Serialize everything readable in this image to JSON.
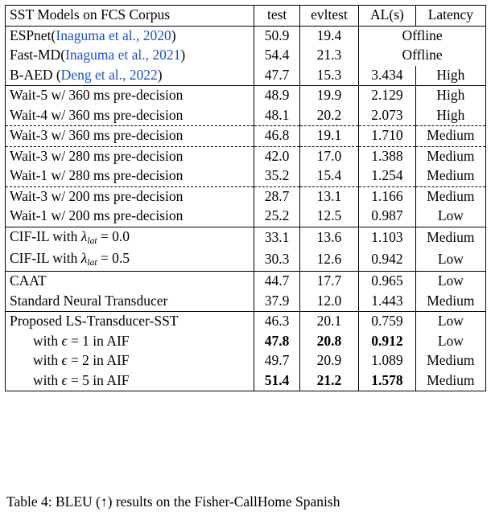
{
  "table": {
    "header": {
      "col0": "SST Models on FCS Corpus",
      "col1": "test",
      "col2": "evltest",
      "col3": "AL(s)",
      "col4": "Latency"
    },
    "groups": [
      {
        "rows": [
          {
            "name_parts": [
              {
                "text": "ESPnet(",
                "style": "plain"
              },
              {
                "text": "Inaguma et al., 2020",
                "style": "cite"
              },
              {
                "text": ")",
                "style": "plain"
              }
            ],
            "test": "50.9",
            "evltest": "19.4",
            "merged": "Offline",
            "al": "",
            "latency": "",
            "merge_last_two": true,
            "dashed_below": false
          },
          {
            "name_parts": [
              {
                "text": "Fast-MD(",
                "style": "plain"
              },
              {
                "text": "Inaguma et al., 2021",
                "style": "cite"
              },
              {
                "text": ")",
                "style": "plain"
              }
            ],
            "test": "54.4",
            "evltest": "21.3",
            "merged": "Offline",
            "al": "",
            "latency": "",
            "merge_last_two": true,
            "dashed_below": false
          },
          {
            "name_parts": [
              {
                "text": "B-AED (",
                "style": "plain"
              },
              {
                "text": "Deng et al., 2022",
                "style": "cite"
              },
              {
                "text": ")",
                "style": "plain"
              }
            ],
            "test": "47.7",
            "evltest": "15.3",
            "merged": "",
            "al": "3.434",
            "latency": "High",
            "merge_last_two": false,
            "dashed_below": false
          }
        ]
      },
      {
        "rows": [
          {
            "name_parts": [
              {
                "text": "Wait-5 w/ 360 ms pre-decision",
                "style": "plain"
              }
            ],
            "test": "48.9",
            "evltest": "19.9",
            "al": "2.129",
            "latency": "High",
            "merged": "",
            "merge_last_two": false,
            "dashed_below": false
          },
          {
            "name_parts": [
              {
                "text": "Wait-4 w/ 360 ms pre-decision",
                "style": "plain"
              }
            ],
            "test": "48.1",
            "evltest": "20.2",
            "al": "2.073",
            "latency": "High",
            "merged": "",
            "merge_last_two": false,
            "dashed_below": true
          },
          {
            "name_parts": [
              {
                "text": "Wait-3 w/ 360 ms pre-decision",
                "style": "plain"
              }
            ],
            "test": "46.8",
            "evltest": "19.1",
            "al": "1.710",
            "latency": "Medium",
            "merged": "",
            "merge_last_two": false,
            "dashed_below": true
          },
          {
            "name_parts": [
              {
                "text": "Wait-3 w/ 280 ms pre-decision",
                "style": "plain"
              }
            ],
            "test": "42.0",
            "evltest": "17.0",
            "al": "1.388",
            "latency": "Medium",
            "merged": "",
            "merge_last_two": false,
            "dashed_below": false
          },
          {
            "name_parts": [
              {
                "text": "Wait-1 w/ 280 ms pre-decision",
                "style": "plain"
              }
            ],
            "test": "35.2",
            "evltest": "15.4",
            "al": "1.254",
            "latency": "Medium",
            "merged": "",
            "merge_last_two": false,
            "dashed_below": true
          },
          {
            "name_parts": [
              {
                "text": "Wait-3 w/ 200 ms pre-decision",
                "style": "plain"
              }
            ],
            "test": "28.7",
            "evltest": "13.1",
            "al": "1.166",
            "latency": "Medium",
            "merged": "",
            "merge_last_two": false,
            "dashed_below": false
          },
          {
            "name_parts": [
              {
                "text": "Wait-1 w/ 200 ms pre-decision",
                "style": "plain"
              }
            ],
            "test": "25.2",
            "evltest": "12.5",
            "al": "0.987",
            "latency": "Low",
            "merged": "",
            "merge_last_two": false,
            "dashed_below": false
          }
        ]
      },
      {
        "rows": [
          {
            "name_parts": [
              {
                "text": "CIF-IL with ",
                "style": "plain"
              },
              {
                "text": "λ",
                "style": "ital"
              },
              {
                "text": "lat",
                "style": "sub"
              },
              {
                "text": " = 0.0",
                "style": "plain"
              }
            ],
            "test": "33.1",
            "evltest": "13.6",
            "al": "1.103",
            "latency": "Medium",
            "merged": "",
            "merge_last_two": false,
            "dashed_below": false
          },
          {
            "name_parts": [
              {
                "text": "CIF-IL with ",
                "style": "plain"
              },
              {
                "text": "λ",
                "style": "ital"
              },
              {
                "text": "lat",
                "style": "sub"
              },
              {
                "text": " = 0.5",
                "style": "plain"
              }
            ],
            "test": "30.3",
            "evltest": "12.6",
            "al": "0.942",
            "latency": "Low",
            "merged": "",
            "merge_last_two": false,
            "dashed_below": false
          }
        ]
      },
      {
        "rows": [
          {
            "name_parts": [
              {
                "text": "CAAT",
                "style": "plain"
              }
            ],
            "test": "44.7",
            "evltest": "17.7",
            "al": "0.965",
            "latency": "Low",
            "merged": "",
            "merge_last_two": false,
            "dashed_below": false
          },
          {
            "name_parts": [
              {
                "text": "Standard Neural Transducer",
                "style": "plain"
              }
            ],
            "test": "37.9",
            "evltest": "12.0",
            "al": "1.443",
            "latency": "Medium",
            "merged": "",
            "merge_last_two": false,
            "dashed_below": false
          }
        ]
      },
      {
        "rows": [
          {
            "name_parts": [
              {
                "text": "Proposed LS-Transducer-SST",
                "style": "plain"
              }
            ],
            "test": "46.3",
            "evltest": "20.1",
            "al": "0.759",
            "latency": "Low",
            "merged": "",
            "merge_last_two": false,
            "dashed_below": false,
            "indent": false
          },
          {
            "name_parts": [
              {
                "text": "with ",
                "style": "plain"
              },
              {
                "text": "ϵ",
                "style": "ital"
              },
              {
                "text": " = 1 in AIF",
                "style": "plain"
              }
            ],
            "test": "47.8",
            "evltest": "20.8",
            "al": "0.912",
            "latency": "Low",
            "merged": "",
            "merge_last_two": false,
            "dashed_below": false,
            "indent": true,
            "bold": [
              "test",
              "evltest",
              "al"
            ]
          },
          {
            "name_parts": [
              {
                "text": "with ",
                "style": "plain"
              },
              {
                "text": "ϵ",
                "style": "ital"
              },
              {
                "text": " = 2 in AIF",
                "style": "plain"
              }
            ],
            "test": "49.7",
            "evltest": "20.9",
            "al": "1.089",
            "latency": "Medium",
            "merged": "",
            "merge_last_two": false,
            "dashed_below": false,
            "indent": true
          },
          {
            "name_parts": [
              {
                "text": "with ",
                "style": "plain"
              },
              {
                "text": "ϵ",
                "style": "ital"
              },
              {
                "text": " = 5 in AIF",
                "style": "plain"
              }
            ],
            "test": "51.4",
            "evltest": "21.2",
            "al": "1.578",
            "latency": "Medium",
            "merged": "",
            "merge_last_two": false,
            "dashed_below": false,
            "indent": true,
            "bold": [
              "test",
              "evltest",
              "al"
            ]
          }
        ]
      }
    ]
  },
  "caption": "Table 4: BLEU (↑) results on the Fisher-CallHome Spanish"
}
